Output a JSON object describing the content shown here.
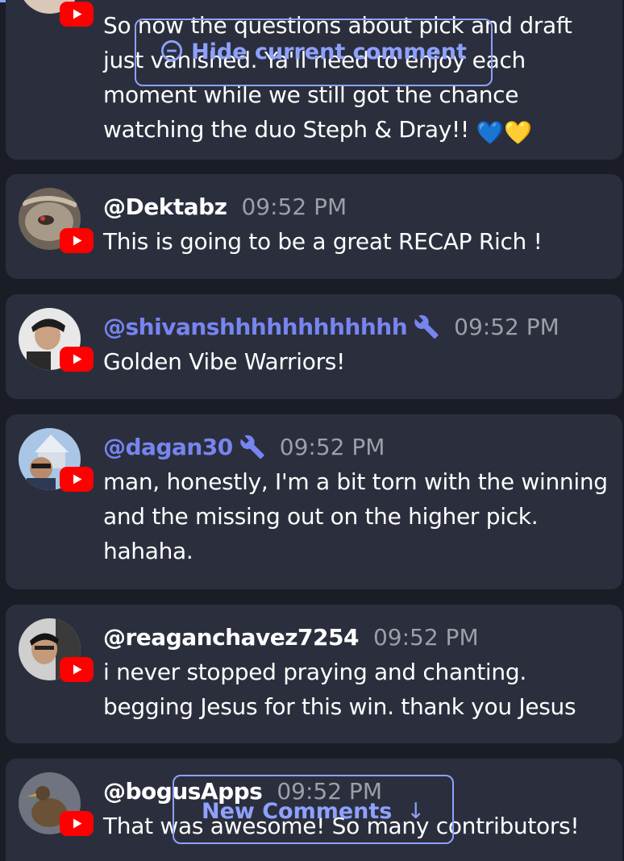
{
  "colors": {
    "background": "#1a1d26",
    "card": "#2b2f3d",
    "moderator_name": "#7785f0",
    "timestamp": "#9b9faa",
    "accent": "#8ea1ff",
    "youtube_red": "#ff0000"
  },
  "comments": [
    {
      "author": "",
      "time": "",
      "text": "So now the questions about pick and draft just vanished. Ya'll need to enjoy each moment while we still got the chance watching the duo Steph & Dray!!",
      "emoji": "💙💛",
      "moderator": false,
      "platform_icon": "youtube-icon"
    },
    {
      "author": "@Dektabz",
      "time": "09:52 PM",
      "text": "This is going to be a great RECAP Rich !",
      "moderator": false,
      "platform_icon": "youtube-icon"
    },
    {
      "author": "@shivanshhhhhhhhhhhh",
      "time": "09:52 PM",
      "text": "Golden Vibe Warriors!",
      "moderator": true,
      "moderator_icon": "wrench-icon",
      "platform_icon": "youtube-icon"
    },
    {
      "author": "@dagan30",
      "time": "09:52 PM",
      "text": "man, honestly, I'm a bit torn with the winning and the missing out on the higher pick. hahaha.",
      "moderator": true,
      "moderator_icon": "wrench-icon",
      "platform_icon": "youtube-icon"
    },
    {
      "author": "@reaganchavez7254",
      "time": "09:52 PM",
      "text": "i never stopped praying and chanting. begging Jesus for this win. thank you Jesus",
      "moderator": false,
      "platform_icon": "youtube-icon"
    },
    {
      "author": "@bogusApps",
      "time": "09:52 PM",
      "text": "That was awesome! So many contributors!",
      "moderator": false,
      "platform_icon": "youtube-icon"
    }
  ],
  "controls": {
    "hide_comment_label": "Hide current comment",
    "hide_comment_icon": "minus-circle-icon",
    "new_comments_label": "New Comments",
    "new_comments_icon": "arrow-down-icon",
    "new_comments_arrow": "↓"
  }
}
